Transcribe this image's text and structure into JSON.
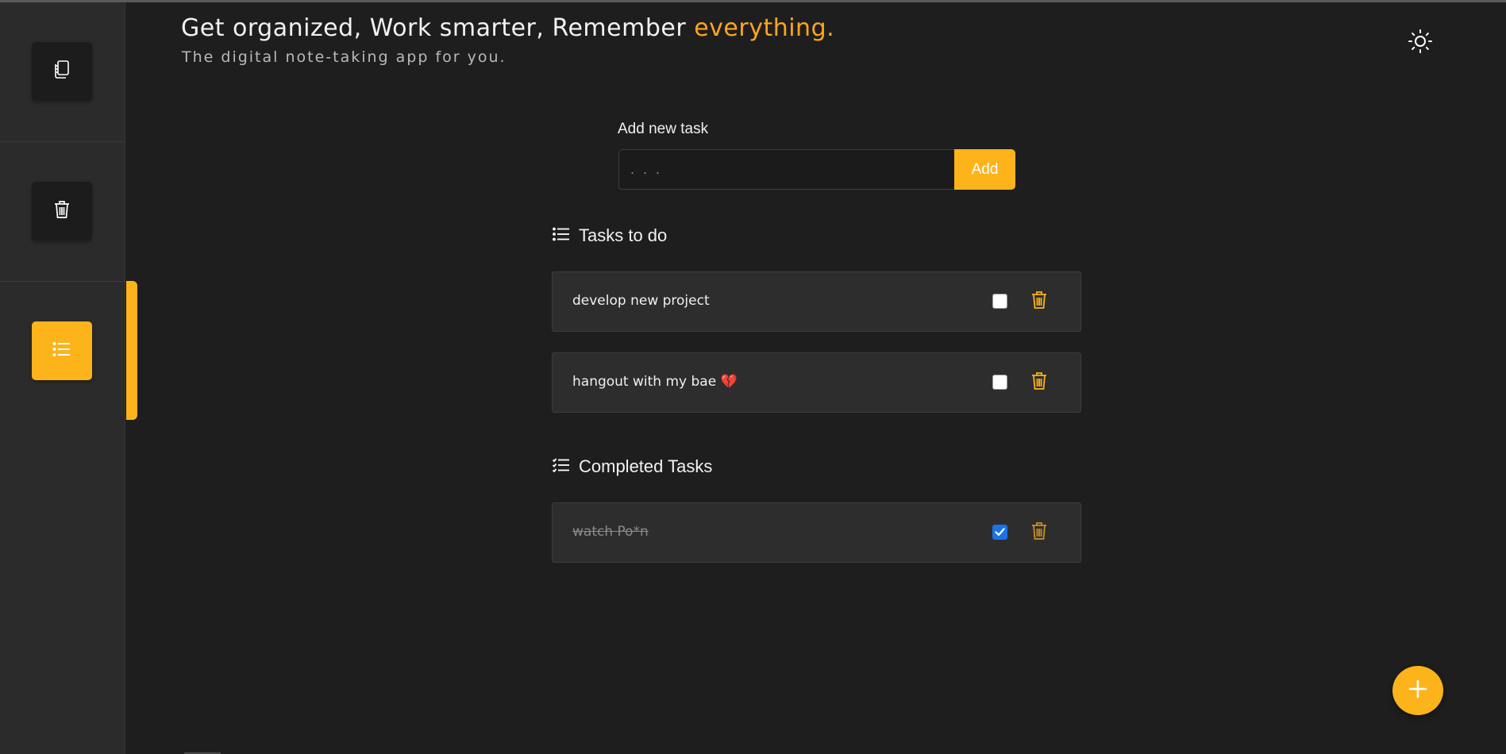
{
  "header": {
    "title_main": "Get organized, Work smarter, Remember ",
    "title_accent": "everything.",
    "subtitle": "The digital note-taking app for you.",
    "theme_icon": "sun-icon"
  },
  "sidebar": {
    "items": [
      {
        "name": "notes",
        "icon": "notes-icon",
        "active": false
      },
      {
        "name": "trash",
        "icon": "trash-icon",
        "active": false
      },
      {
        "name": "tasks",
        "icon": "list-icon",
        "active": true
      }
    ]
  },
  "add_task": {
    "label": "Add new task",
    "placeholder": ". . .",
    "value": "",
    "button_label": "Add"
  },
  "todo": {
    "heading": "Tasks to do",
    "items": [
      {
        "text": "develop new project",
        "checked": false
      },
      {
        "text": "hangout with my bae 💔",
        "checked": false
      }
    ]
  },
  "completed": {
    "heading": "Completed Tasks",
    "items": [
      {
        "text": "watch Po*n",
        "checked": true
      }
    ]
  },
  "colors": {
    "accent": "#fdb31a",
    "background": "#1e1e1e",
    "sidebar": "#2b2b2b",
    "card": "#2d2d2d",
    "checkbox_checked": "#1a73e8"
  },
  "fab": {
    "icon": "plus-icon"
  }
}
